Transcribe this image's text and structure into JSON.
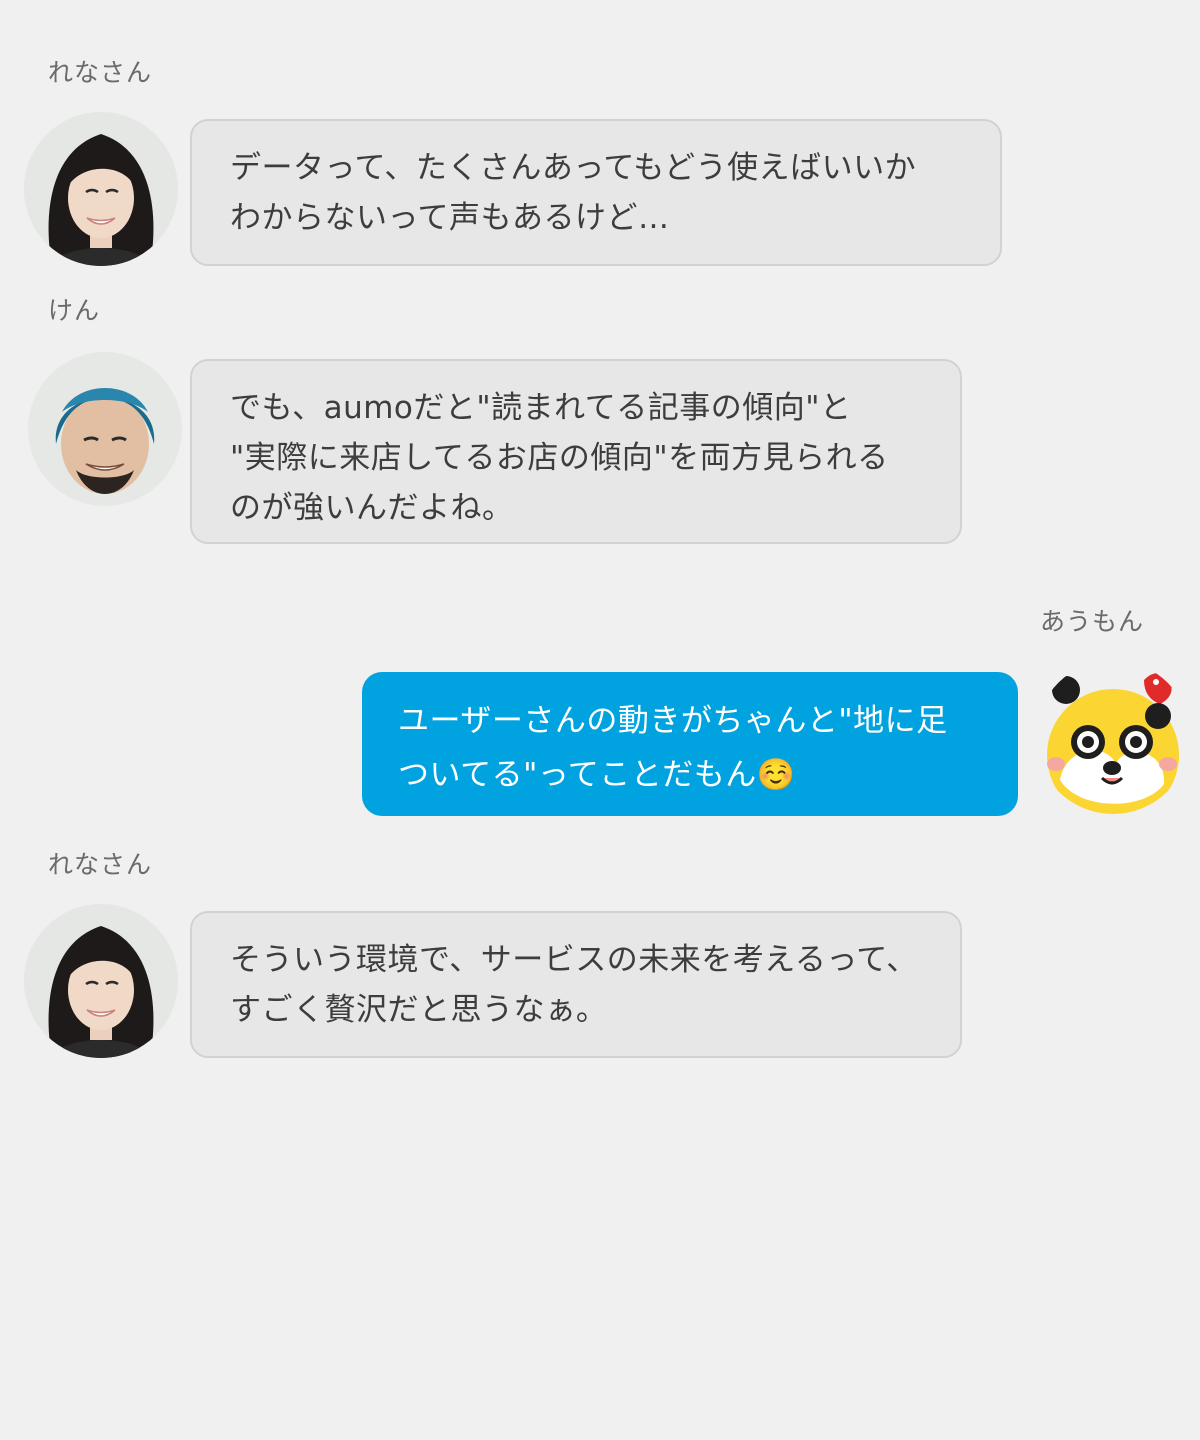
{
  "messages": [
    {
      "sender": "れなさん",
      "text": "データって、たくさんあってもどう使えばいいか\nわからないって声もあるけど…",
      "avatar_icon": "person-photo-woman"
    },
    {
      "sender": "けん",
      "text": "でも、aumoだと\"読まれてる記事の傾向\"と\n\"実際に来店してるお店の傾向\"を両方見られる\nのが強いんだよね。",
      "avatar_icon": "person-photo-man-blue-hair"
    },
    {
      "sender": "あうもん",
      "text": "ユーザーさんの動きがちゃんと\"地に足\nついてる\"ってことだもん☺️",
      "avatar_icon": "mascot-dog"
    },
    {
      "sender": "れなさん",
      "text": "そういう環境で、サービスの未来を考えるって、\nすごく贅沢だと思うなぁ。",
      "avatar_icon": "person-photo-woman"
    }
  ],
  "colors": {
    "background": "#f0f0f0",
    "bubble_other": "#e7e7e7",
    "bubble_mine": "#00a3e0",
    "text": "#3d3d3d"
  }
}
